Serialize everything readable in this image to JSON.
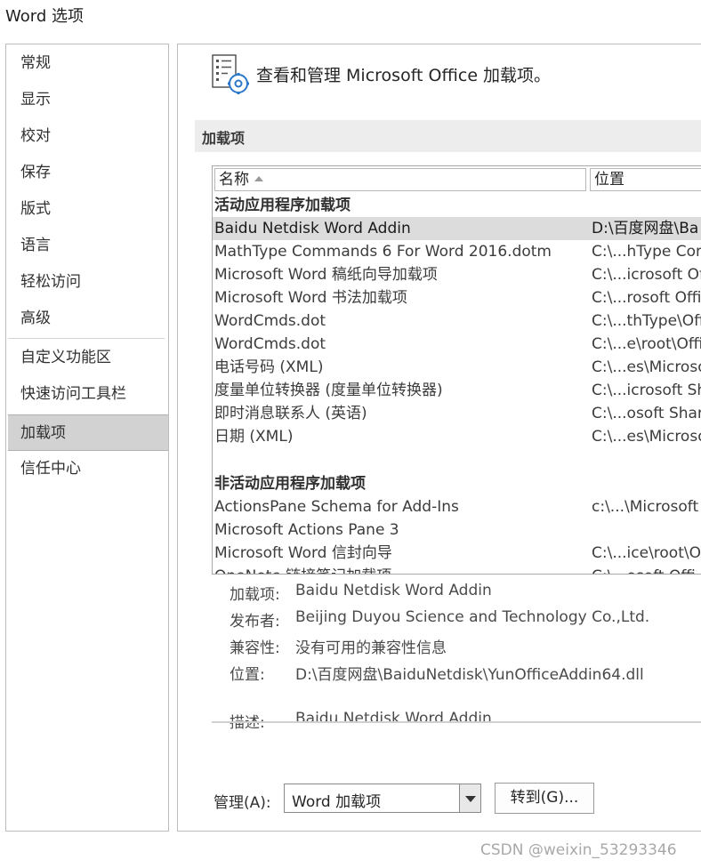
{
  "window": {
    "title": "Word 选项"
  },
  "nav": {
    "items": [
      {
        "label": "常规",
        "selected": false
      },
      {
        "label": "显示",
        "selected": false
      },
      {
        "label": "校对",
        "selected": false
      },
      {
        "label": "保存",
        "selected": false
      },
      {
        "label": "版式",
        "selected": false
      },
      {
        "label": "语言",
        "selected": false
      },
      {
        "label": "轻松访问",
        "selected": false
      },
      {
        "label": "高级",
        "selected": false
      },
      {
        "label": "自定义功能区",
        "selected": false
      },
      {
        "label": "快速访问工具栏",
        "selected": false
      },
      {
        "label": "加载项",
        "selected": true
      },
      {
        "label": "信任中心",
        "selected": false
      }
    ]
  },
  "header": {
    "icon": "addins-settings-icon",
    "text": "查看和管理 Microsoft Office 加载项。"
  },
  "section": {
    "title": "加载项"
  },
  "list": {
    "columns": {
      "name": "名称",
      "location": "位置"
    },
    "active_group": {
      "title": "活动应用程序加载项",
      "rows": [
        {
          "name": "Baidu Netdisk Word Addin",
          "location": "D:\\百度网盘\\Ba",
          "selected": true
        },
        {
          "name": "MathType Commands 6 For Word 2016.dotm",
          "location": "C:\\...hType Con"
        },
        {
          "name": "Microsoft Word 稿纸向导加载项",
          "location": "C:\\...icrosoft Of"
        },
        {
          "name": "Microsoft Word 书法加载项",
          "location": "C:\\...rosoft Offic"
        },
        {
          "name": "WordCmds.dot",
          "location": "C:\\...thType\\Off"
        },
        {
          "name": "WordCmds.dot",
          "location": "C:\\...e\\root\\Offi"
        },
        {
          "name": "电话号码 (XML)",
          "location": "C:\\...es\\Microso"
        },
        {
          "name": "度量单位转换器 (度量单位转换器)",
          "location": "C:\\...icrosoft Sh"
        },
        {
          "name": "即时消息联系人 (英语)",
          "location": "C:\\...osoft Share"
        },
        {
          "name": "日期 (XML)",
          "location": "C:\\...es\\Microso"
        }
      ]
    },
    "inactive_group": {
      "title": "非活动应用程序加载项",
      "rows": [
        {
          "name": "ActionsPane Schema for Add-Ins",
          "location": "c:\\...\\Microsoft"
        },
        {
          "name": "Microsoft Actions Pane 3",
          "location": ""
        },
        {
          "name": "Microsoft Word 信封向导",
          "location": "C:\\...ice\\root\\O"
        },
        {
          "name": "OneNote 链接笔记加载项",
          "location": "C:\\...osoft Offi"
        }
      ]
    }
  },
  "details": {
    "addin_label": "加载项:",
    "addin_value": "Baidu Netdisk Word Addin",
    "publisher_label": "发布者:",
    "publisher_value": "Beijing Duyou Science and Technology Co.,Ltd.",
    "compat_label": "兼容性:",
    "compat_value": "没有可用的兼容性信息",
    "location_label": "位置:",
    "location_value": "D:\\百度网盘\\BaiduNetdisk\\YunOfficeAddin64.dll",
    "desc_label": "描述:",
    "desc_value": "Baidu Netdisk Word Addin"
  },
  "manage": {
    "label": "管理(A):",
    "selected": "Word 加载项",
    "go_label": "转到(G)..."
  },
  "watermark": "CSDN @weixin_53293346"
}
